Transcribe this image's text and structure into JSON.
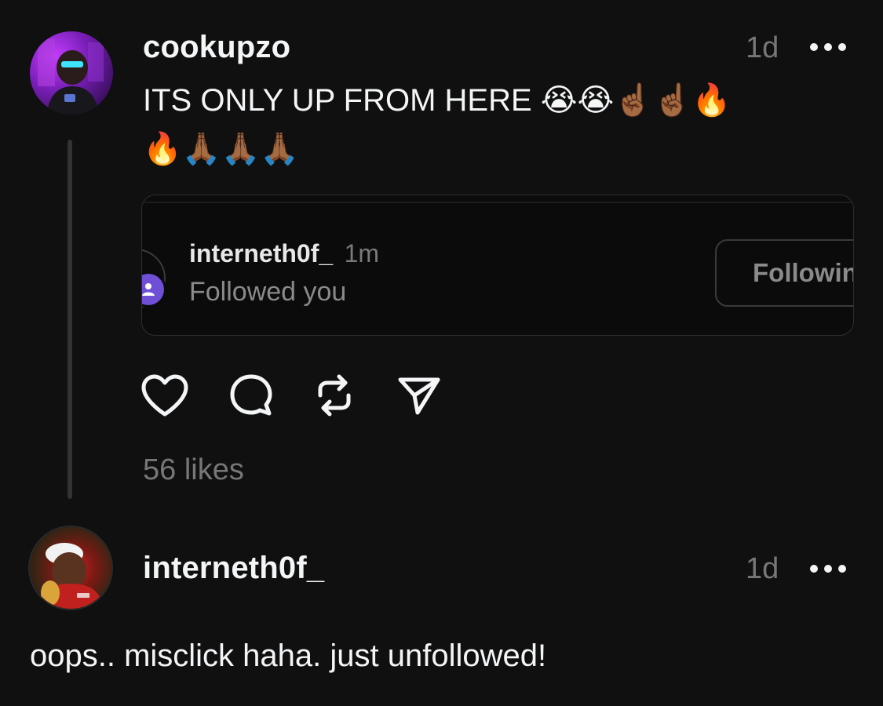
{
  "post": {
    "username": "cookupzo",
    "time": "1d",
    "line1": "ITS ONLY UP FROM HERE 😭😭☝🏾☝🏾🔥",
    "line2": "🔥🙏🏾🙏🏾🙏🏾",
    "likes": "56 likes",
    "embed": {
      "username": "interneth0f_",
      "time": "1m",
      "subtitle": "Followed you",
      "button_label": "Following"
    },
    "actions": [
      {
        "name": "like",
        "icon": "heart-icon"
      },
      {
        "name": "reply",
        "icon": "comment-icon"
      },
      {
        "name": "repost",
        "icon": "repost-icon"
      },
      {
        "name": "share",
        "icon": "send-icon"
      }
    ]
  },
  "reply": {
    "username": "interneth0f_",
    "time": "1d",
    "text": "oops.. misclick haha. just unfollowed!"
  },
  "colors": {
    "background": "#101010",
    "text": "#f3f5f7",
    "muted": "#777777",
    "badge": "#6e4fd6"
  }
}
